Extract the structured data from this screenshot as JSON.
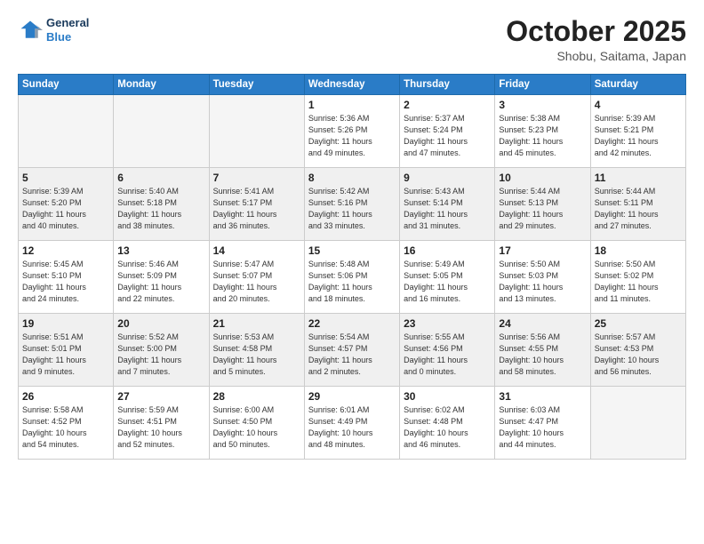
{
  "header": {
    "logo_line1": "General",
    "logo_line2": "Blue",
    "month": "October 2025",
    "location": "Shobu, Saitama, Japan"
  },
  "weekdays": [
    "Sunday",
    "Monday",
    "Tuesday",
    "Wednesday",
    "Thursday",
    "Friday",
    "Saturday"
  ],
  "weeks": [
    [
      {
        "day": "",
        "info": "",
        "empty": true
      },
      {
        "day": "",
        "info": "",
        "empty": true
      },
      {
        "day": "",
        "info": "",
        "empty": true
      },
      {
        "day": "1",
        "info": "Sunrise: 5:36 AM\nSunset: 5:26 PM\nDaylight: 11 hours\nand 49 minutes."
      },
      {
        "day": "2",
        "info": "Sunrise: 5:37 AM\nSunset: 5:24 PM\nDaylight: 11 hours\nand 47 minutes."
      },
      {
        "day": "3",
        "info": "Sunrise: 5:38 AM\nSunset: 5:23 PM\nDaylight: 11 hours\nand 45 minutes."
      },
      {
        "day": "4",
        "info": "Sunrise: 5:39 AM\nSunset: 5:21 PM\nDaylight: 11 hours\nand 42 minutes."
      }
    ],
    [
      {
        "day": "5",
        "info": "Sunrise: 5:39 AM\nSunset: 5:20 PM\nDaylight: 11 hours\nand 40 minutes.",
        "shaded": true
      },
      {
        "day": "6",
        "info": "Sunrise: 5:40 AM\nSunset: 5:18 PM\nDaylight: 11 hours\nand 38 minutes.",
        "shaded": true
      },
      {
        "day": "7",
        "info": "Sunrise: 5:41 AM\nSunset: 5:17 PM\nDaylight: 11 hours\nand 36 minutes.",
        "shaded": true
      },
      {
        "day": "8",
        "info": "Sunrise: 5:42 AM\nSunset: 5:16 PM\nDaylight: 11 hours\nand 33 minutes.",
        "shaded": true
      },
      {
        "day": "9",
        "info": "Sunrise: 5:43 AM\nSunset: 5:14 PM\nDaylight: 11 hours\nand 31 minutes.",
        "shaded": true
      },
      {
        "day": "10",
        "info": "Sunrise: 5:44 AM\nSunset: 5:13 PM\nDaylight: 11 hours\nand 29 minutes.",
        "shaded": true
      },
      {
        "day": "11",
        "info": "Sunrise: 5:44 AM\nSunset: 5:11 PM\nDaylight: 11 hours\nand 27 minutes.",
        "shaded": true
      }
    ],
    [
      {
        "day": "12",
        "info": "Sunrise: 5:45 AM\nSunset: 5:10 PM\nDaylight: 11 hours\nand 24 minutes."
      },
      {
        "day": "13",
        "info": "Sunrise: 5:46 AM\nSunset: 5:09 PM\nDaylight: 11 hours\nand 22 minutes."
      },
      {
        "day": "14",
        "info": "Sunrise: 5:47 AM\nSunset: 5:07 PM\nDaylight: 11 hours\nand 20 minutes."
      },
      {
        "day": "15",
        "info": "Sunrise: 5:48 AM\nSunset: 5:06 PM\nDaylight: 11 hours\nand 18 minutes."
      },
      {
        "day": "16",
        "info": "Sunrise: 5:49 AM\nSunset: 5:05 PM\nDaylight: 11 hours\nand 16 minutes."
      },
      {
        "day": "17",
        "info": "Sunrise: 5:50 AM\nSunset: 5:03 PM\nDaylight: 11 hours\nand 13 minutes."
      },
      {
        "day": "18",
        "info": "Sunrise: 5:50 AM\nSunset: 5:02 PM\nDaylight: 11 hours\nand 11 minutes."
      }
    ],
    [
      {
        "day": "19",
        "info": "Sunrise: 5:51 AM\nSunset: 5:01 PM\nDaylight: 11 hours\nand 9 minutes.",
        "shaded": true
      },
      {
        "day": "20",
        "info": "Sunrise: 5:52 AM\nSunset: 5:00 PM\nDaylight: 11 hours\nand 7 minutes.",
        "shaded": true
      },
      {
        "day": "21",
        "info": "Sunrise: 5:53 AM\nSunset: 4:58 PM\nDaylight: 11 hours\nand 5 minutes.",
        "shaded": true
      },
      {
        "day": "22",
        "info": "Sunrise: 5:54 AM\nSunset: 4:57 PM\nDaylight: 11 hours\nand 2 minutes.",
        "shaded": true
      },
      {
        "day": "23",
        "info": "Sunrise: 5:55 AM\nSunset: 4:56 PM\nDaylight: 11 hours\nand 0 minutes.",
        "shaded": true
      },
      {
        "day": "24",
        "info": "Sunrise: 5:56 AM\nSunset: 4:55 PM\nDaylight: 10 hours\nand 58 minutes.",
        "shaded": true
      },
      {
        "day": "25",
        "info": "Sunrise: 5:57 AM\nSunset: 4:53 PM\nDaylight: 10 hours\nand 56 minutes.",
        "shaded": true
      }
    ],
    [
      {
        "day": "26",
        "info": "Sunrise: 5:58 AM\nSunset: 4:52 PM\nDaylight: 10 hours\nand 54 minutes."
      },
      {
        "day": "27",
        "info": "Sunrise: 5:59 AM\nSunset: 4:51 PM\nDaylight: 10 hours\nand 52 minutes."
      },
      {
        "day": "28",
        "info": "Sunrise: 6:00 AM\nSunset: 4:50 PM\nDaylight: 10 hours\nand 50 minutes."
      },
      {
        "day": "29",
        "info": "Sunrise: 6:01 AM\nSunset: 4:49 PM\nDaylight: 10 hours\nand 48 minutes."
      },
      {
        "day": "30",
        "info": "Sunrise: 6:02 AM\nSunset: 4:48 PM\nDaylight: 10 hours\nand 46 minutes."
      },
      {
        "day": "31",
        "info": "Sunrise: 6:03 AM\nSunset: 4:47 PM\nDaylight: 10 hours\nand 44 minutes."
      },
      {
        "day": "",
        "info": "",
        "empty": true
      }
    ]
  ]
}
